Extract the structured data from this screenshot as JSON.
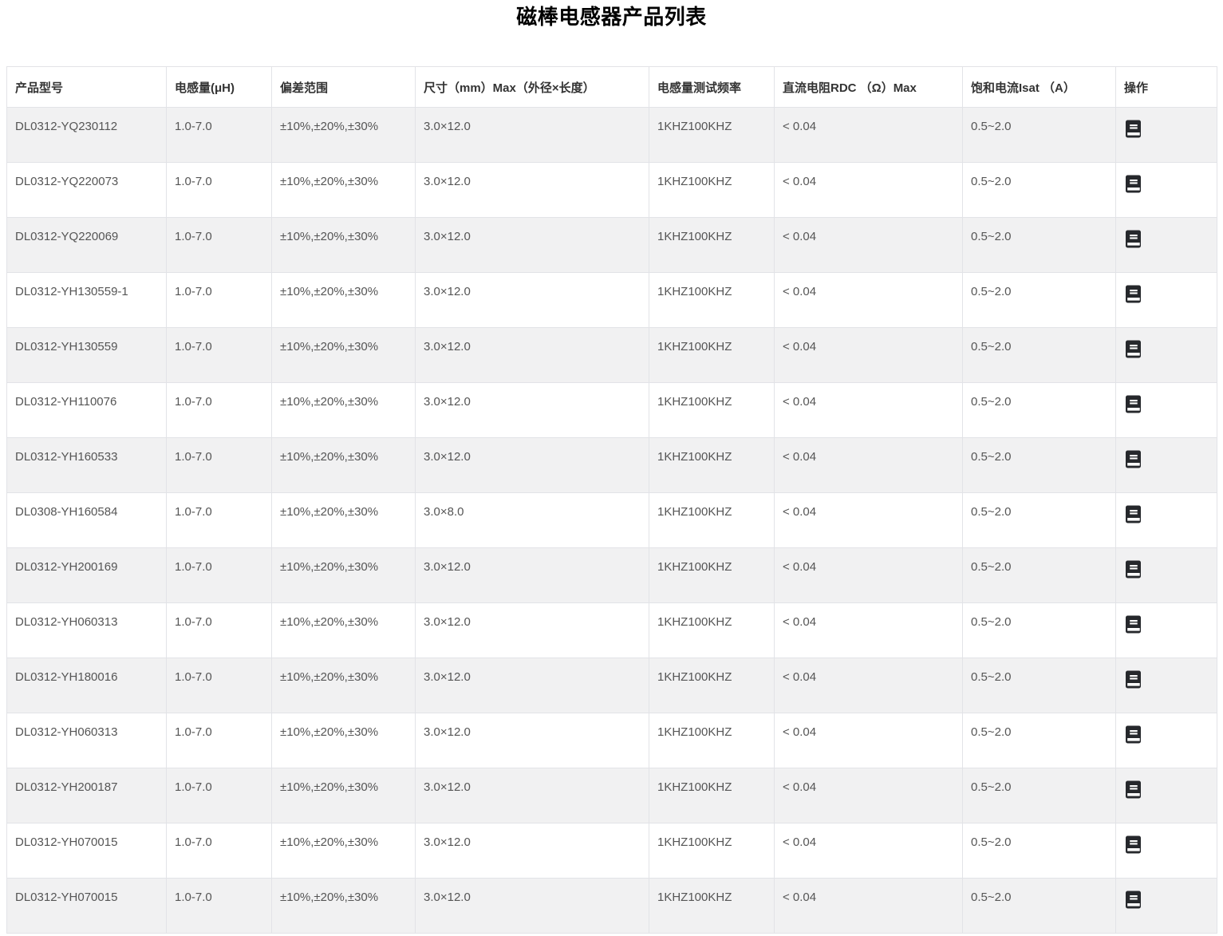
{
  "page": {
    "title": "磁棒电感器产品列表"
  },
  "colors": {
    "stripe_row_bg": "#f1f1f2",
    "border": "#e2e3e7",
    "header_text": "#333333",
    "cell_text": "#555555",
    "icon_fill": "#26282c"
  },
  "icons": {
    "action": "notebook-icon"
  },
  "table": {
    "columns": [
      {
        "key": "model",
        "label": "产品型号"
      },
      {
        "key": "inductance",
        "label": "电感量(μH)"
      },
      {
        "key": "tolerance",
        "label": "偏差范围"
      },
      {
        "key": "size",
        "label": "尺寸（mm）Max（外径×长度）"
      },
      {
        "key": "freq",
        "label": "电感量测试频率"
      },
      {
        "key": "rdc",
        "label": "直流电阻RDC （Ω）Max"
      },
      {
        "key": "isat",
        "label": "饱和电流Isat （A）"
      },
      {
        "key": "action",
        "label": "操作"
      }
    ],
    "rows": [
      {
        "model": "DL0312-YQ230112",
        "inductance": "1.0-7.0",
        "tolerance": "±10%,±20%,±30%",
        "size": "3.0×12.0",
        "freq": "1KHZ100KHZ",
        "rdc": "< 0.04",
        "isat": "0.5~2.0"
      },
      {
        "model": "DL0312-YQ220073",
        "inductance": "1.0-7.0",
        "tolerance": "±10%,±20%,±30%",
        "size": "3.0×12.0",
        "freq": "1KHZ100KHZ",
        "rdc": "< 0.04",
        "isat": "0.5~2.0"
      },
      {
        "model": "DL0312-YQ220069",
        "inductance": "1.0-7.0",
        "tolerance": "±10%,±20%,±30%",
        "size": "3.0×12.0",
        "freq": "1KHZ100KHZ",
        "rdc": "< 0.04",
        "isat": "0.5~2.0"
      },
      {
        "model": "DL0312-YH130559-1",
        "inductance": "1.0-7.0",
        "tolerance": "±10%,±20%,±30%",
        "size": "3.0×12.0",
        "freq": "1KHZ100KHZ",
        "rdc": "< 0.04",
        "isat": "0.5~2.0"
      },
      {
        "model": "DL0312-YH130559",
        "inductance": "1.0-7.0",
        "tolerance": "±10%,±20%,±30%",
        "size": "3.0×12.0",
        "freq": "1KHZ100KHZ",
        "rdc": "< 0.04",
        "isat": "0.5~2.0"
      },
      {
        "model": "DL0312-YH110076",
        "inductance": "1.0-7.0",
        "tolerance": "±10%,±20%,±30%",
        "size": "3.0×12.0",
        "freq": "1KHZ100KHZ",
        "rdc": "< 0.04",
        "isat": "0.5~2.0"
      },
      {
        "model": "DL0312-YH160533",
        "inductance": "1.0-7.0",
        "tolerance": "±10%,±20%,±30%",
        "size": "3.0×12.0",
        "freq": "1KHZ100KHZ",
        "rdc": "< 0.04",
        "isat": "0.5~2.0"
      },
      {
        "model": "DL0308-YH160584",
        "inductance": "1.0-7.0",
        "tolerance": "±10%,±20%,±30%",
        "size": "3.0×8.0",
        "freq": "1KHZ100KHZ",
        "rdc": "< 0.04",
        "isat": "0.5~2.0"
      },
      {
        "model": "DL0312-YH200169",
        "inductance": "1.0-7.0",
        "tolerance": "±10%,±20%,±30%",
        "size": "3.0×12.0",
        "freq": "1KHZ100KHZ",
        "rdc": "< 0.04",
        "isat": "0.5~2.0"
      },
      {
        "model": "DL0312-YH060313",
        "inductance": "1.0-7.0",
        "tolerance": "±10%,±20%,±30%",
        "size": "3.0×12.0",
        "freq": "1KHZ100KHZ",
        "rdc": "< 0.04",
        "isat": "0.5~2.0"
      },
      {
        "model": "DL0312-YH180016",
        "inductance": "1.0-7.0",
        "tolerance": "±10%,±20%,±30%",
        "size": "3.0×12.0",
        "freq": "1KHZ100KHZ",
        "rdc": "< 0.04",
        "isat": "0.5~2.0"
      },
      {
        "model": "DL0312-YH060313",
        "inductance": "1.0-7.0",
        "tolerance": "±10%,±20%,±30%",
        "size": "3.0×12.0",
        "freq": "1KHZ100KHZ",
        "rdc": "< 0.04",
        "isat": "0.5~2.0"
      },
      {
        "model": "DL0312-YH200187",
        "inductance": "1.0-7.0",
        "tolerance": "±10%,±20%,±30%",
        "size": "3.0×12.0",
        "freq": "1KHZ100KHZ",
        "rdc": "< 0.04",
        "isat": "0.5~2.0"
      },
      {
        "model": "DL0312-YH070015",
        "inductance": "1.0-7.0",
        "tolerance": "±10%,±20%,±30%",
        "size": "3.0×12.0",
        "freq": "1KHZ100KHZ",
        "rdc": "< 0.04",
        "isat": "0.5~2.0"
      },
      {
        "model": "DL0312-YH070015",
        "inductance": "1.0-7.0",
        "tolerance": "±10%,±20%,±30%",
        "size": "3.0×12.0",
        "freq": "1KHZ100KHZ",
        "rdc": "< 0.04",
        "isat": "0.5~2.0"
      }
    ]
  }
}
